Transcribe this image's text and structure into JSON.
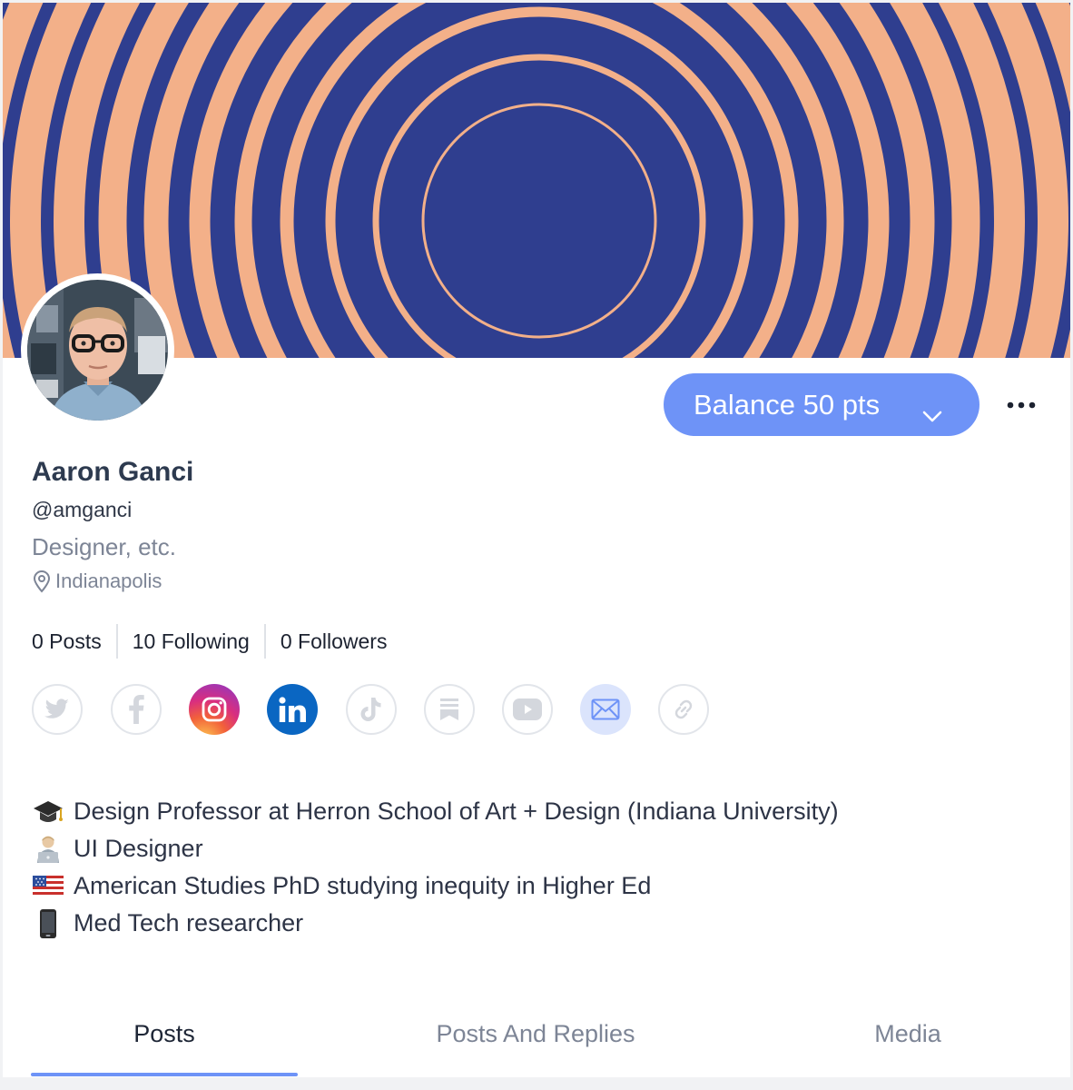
{
  "profile": {
    "name": "Aaron Ganci",
    "handle": "@amganci",
    "tagline": "Designer, etc.",
    "location": "Indianapolis"
  },
  "actions": {
    "balance_label": "Balance 50 pts",
    "more_label": "•••"
  },
  "stats": [
    {
      "label": "0 Posts"
    },
    {
      "label": "10 Following"
    },
    {
      "label": "0 Followers"
    }
  ],
  "socials": [
    {
      "name": "twitter-icon",
      "active": false
    },
    {
      "name": "facebook-icon",
      "active": false
    },
    {
      "name": "instagram-icon",
      "active": true
    },
    {
      "name": "linkedin-icon",
      "active": true
    },
    {
      "name": "tiktok-icon",
      "active": false
    },
    {
      "name": "substack-icon",
      "active": false
    },
    {
      "name": "youtube-icon",
      "active": false
    },
    {
      "name": "email-icon",
      "active": true
    },
    {
      "name": "link-icon",
      "active": false
    }
  ],
  "bio": [
    {
      "emoji": "graduation-cap-emoji",
      "text": "Design Professor at Herron School of Art + Design (Indiana University)"
    },
    {
      "emoji": "technologist-emoji",
      "text": "UI Designer"
    },
    {
      "emoji": "us-flag-emoji",
      "text": "American Studies PhD studying inequity in Higher Ed"
    },
    {
      "emoji": "mobile-phone-emoji",
      "text": "Med Tech researcher"
    }
  ],
  "tabs": [
    {
      "label": "Posts",
      "active": true
    },
    {
      "label": "Posts And Replies",
      "active": false
    },
    {
      "label": "Media",
      "active": false
    }
  ],
  "colors": {
    "accent": "#6e93f7",
    "banner_orange": "#f3b089",
    "banner_blue": "#2f3e8f",
    "banner_edge": "#e5652a"
  }
}
